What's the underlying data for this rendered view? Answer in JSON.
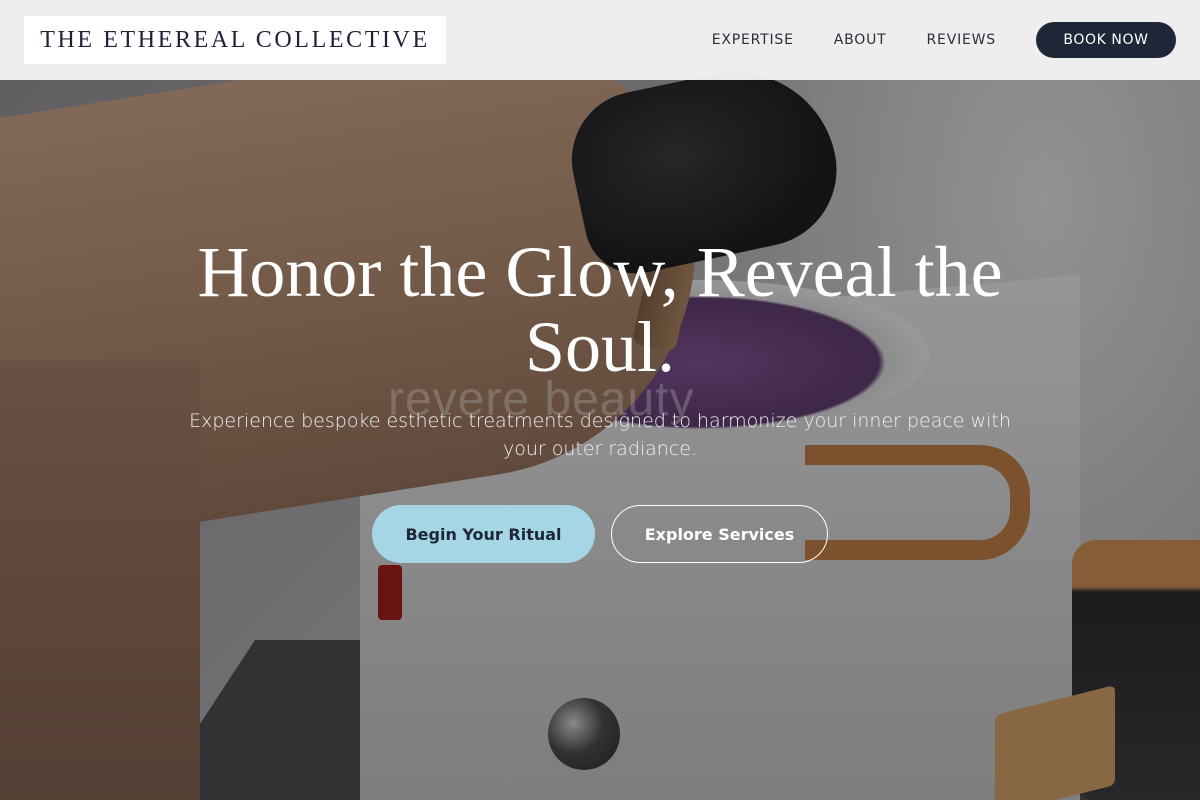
{
  "header": {
    "logo_text": "THE ETHEREAL COLLECTIVE",
    "nav": [
      {
        "label": "EXPERTISE"
      },
      {
        "label": "ABOUT"
      },
      {
        "label": "REVIEWS"
      }
    ],
    "book_label": "BOOK NOW"
  },
  "hero": {
    "headline": "Honor the Glow, Reveal the Soul.",
    "subtext": "Experience bespoke esthetic treatments designed to harmonize your inner peace with your outer radiance.",
    "primary_cta": "Begin Your Ritual",
    "secondary_cta": "Explore Services",
    "photo_watermark": "revere beauty"
  },
  "colors": {
    "navy": "#1d2738",
    "accent_light_blue": "#a6d6e6",
    "header_bg": "#f2f2f3"
  }
}
